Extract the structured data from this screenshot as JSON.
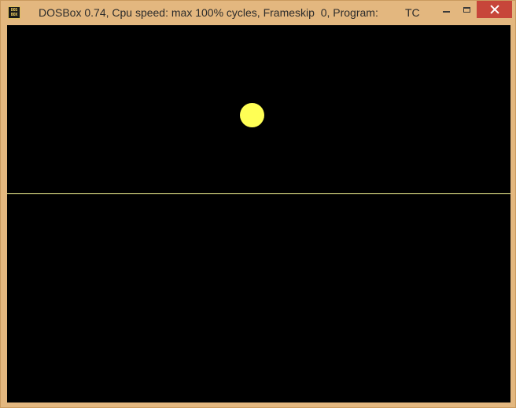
{
  "window": {
    "title": "DOSBox 0.74, Cpu speed: max 100% cycles, Frameskip  0, Program:",
    "program": "TC",
    "app_icon": {
      "name": "dosbox-icon",
      "line1": "DOS",
      "line2": "BOX"
    },
    "controls": {
      "minimize": "minimize-icon",
      "maximize": "maximize-icon",
      "close": "close-icon"
    }
  },
  "colors": {
    "frame": "#e3b77f",
    "close_button": "#c7463a",
    "screen_background": "#000000",
    "ball": "#ffff55",
    "ground_line": "#ffff99"
  }
}
